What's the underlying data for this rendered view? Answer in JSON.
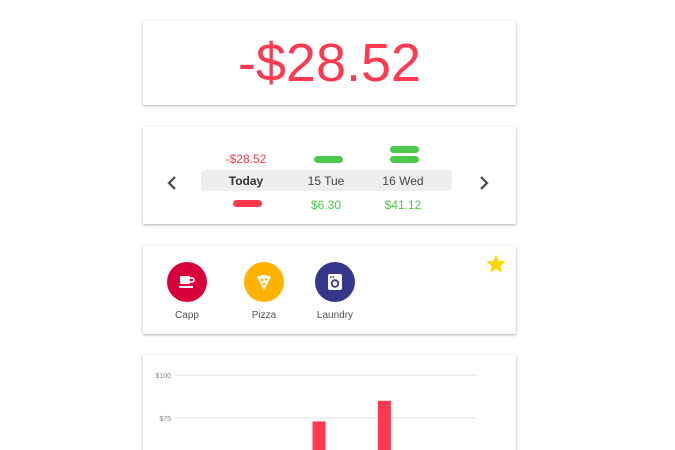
{
  "balance": {
    "amount": "-$28.52",
    "color": "#ff3950"
  },
  "days": {
    "prev_icon": "chevron-left-icon",
    "next_icon": "chevron-right-icon",
    "items": [
      {
        "label": "Today",
        "top_amount": "-$28.52",
        "bottom_amount": "",
        "selected": true
      },
      {
        "label": "15 Tue",
        "top_amount": "",
        "bottom_amount": "$6.30",
        "selected": false
      },
      {
        "label": "16 Wed",
        "top_amount": "",
        "bottom_amount": "$41.12",
        "selected": false
      }
    ]
  },
  "favorites": {
    "items": [
      {
        "label": "Capp",
        "icon": "coffee-cup-icon",
        "color": "#d8003a"
      },
      {
        "label": "Pizza",
        "icon": "pizza-slice-icon",
        "color": "#ffb300"
      },
      {
        "label": "Laundry",
        "icon": "washing-machine-icon",
        "color": "#35378a"
      }
    ],
    "star_icon": "star-icon",
    "star_color": "#ffd600"
  },
  "chart_data": {
    "type": "bar",
    "y_tick_labels": [
      "$100",
      "$75"
    ],
    "y_ticks": [
      100,
      75
    ],
    "values": [
      null,
      null,
      73,
      85,
      null
    ],
    "bar_color": "#ff3950",
    "grid": true
  }
}
